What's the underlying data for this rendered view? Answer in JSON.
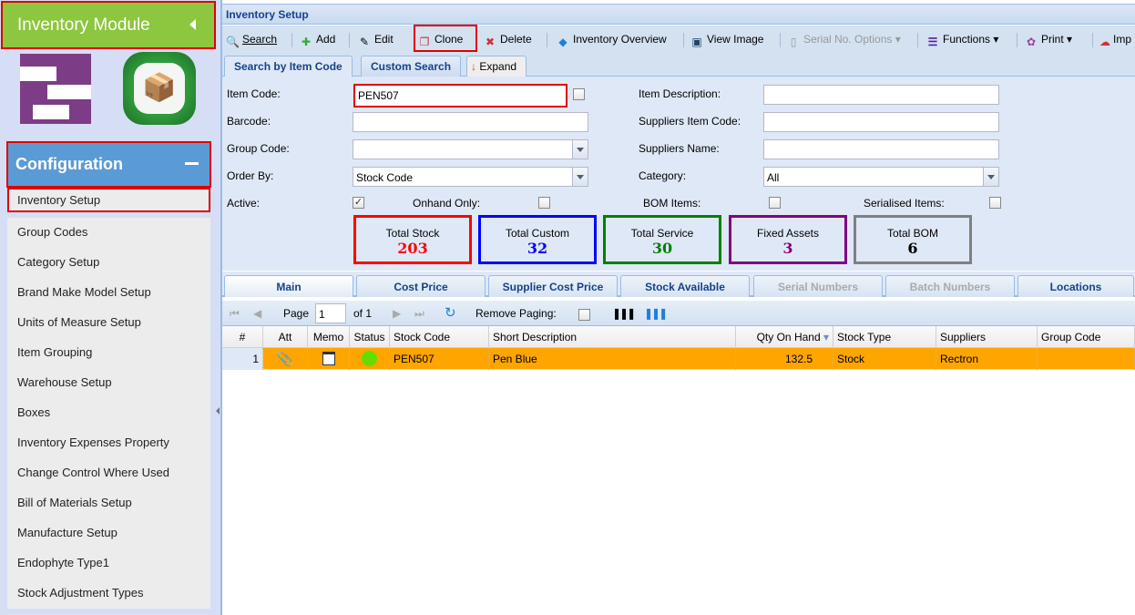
{
  "sidebar": {
    "module_title": "Inventory Module",
    "section_title": "Configuration",
    "items": [
      {
        "label": "Inventory Setup"
      },
      {
        "label": "Group Codes"
      },
      {
        "label": "Category Setup"
      },
      {
        "label": "Brand Make Model Setup"
      },
      {
        "label": "Units of Measure Setup"
      },
      {
        "label": "Item Grouping"
      },
      {
        "label": "Warehouse Setup"
      },
      {
        "label": "Boxes"
      },
      {
        "label": "Inventory Expenses Property"
      },
      {
        "label": "Change Control Where Used"
      },
      {
        "label": "Bill of Materials Setup"
      },
      {
        "label": "Manufacture Setup"
      },
      {
        "label": "Endophyte Type1"
      },
      {
        "label": "Stock Adjustment Types"
      }
    ]
  },
  "panel": {
    "title": "Inventory Setup"
  },
  "toolbar": {
    "search": "Search",
    "add": "Add",
    "edit": "Edit",
    "clone": "Clone",
    "delete": "Delete",
    "inventory_overview": "Inventory Overview",
    "view_image": "View Image",
    "serial_options": "Serial No. Options",
    "functions": "Functions",
    "print": "Print",
    "import": "Imp"
  },
  "search_tabs": {
    "by_item_code": "Search by Item Code",
    "custom": "Custom Search",
    "expand": "Expand"
  },
  "form": {
    "item_code_label": "Item Code:",
    "item_code_value": "PEN507",
    "barcode_label": "Barcode:",
    "barcode_value": "",
    "group_code_label": "Group Code:",
    "group_code_value": "",
    "order_by_label": "Order By:",
    "order_by_value": "Stock Code",
    "active_label": "Active:",
    "active_checked": true,
    "onhand_label": "Onhand Only:",
    "onhand_checked": false,
    "bom_label": "BOM Items:",
    "bom_checked": false,
    "serialised_label": "Serialised Items:",
    "serialised_checked": false,
    "item_desc_label": "Item Description:",
    "item_desc_value": "",
    "supp_item_code_label": "Suppliers Item Code:",
    "supp_item_code_value": "",
    "supp_name_label": "Suppliers Name:",
    "supp_name_value": "",
    "category_label": "Category:",
    "category_value": "All"
  },
  "stats": [
    {
      "label": "Total Stock",
      "value": "203",
      "color": "#ff0000"
    },
    {
      "label": "Total Custom",
      "value": "32",
      "color": "#0000ff"
    },
    {
      "label": "Total Service",
      "value": "30",
      "color": "#008000"
    },
    {
      "label": "Fixed Assets",
      "value": "3",
      "color": "#800080"
    },
    {
      "label": "Total BOM",
      "value": "6",
      "color": "#808080"
    }
  ],
  "detail_tabs": [
    {
      "label": "Main"
    },
    {
      "label": "Cost Price"
    },
    {
      "label": "Supplier Cost Price"
    },
    {
      "label": "Stock Available"
    },
    {
      "label": "Serial Numbers"
    },
    {
      "label": "Batch Numbers"
    },
    {
      "label": "Locations"
    }
  ],
  "pager": {
    "page_label": "Page",
    "page_value": "1",
    "of_label": "of 1",
    "remove_paging_label": "Remove Paging:"
  },
  "grid": {
    "columns": [
      "#",
      "Att",
      "Memo",
      "Status",
      "Stock Code",
      "Short Description",
      "Qty On Hand",
      "Stock Type",
      "Suppliers",
      "Group Code"
    ],
    "rows": [
      {
        "num": "1",
        "status_color": "#66dd00",
        "stock_code": "PEN507",
        "short_description": "Pen Blue",
        "qty_on_hand": "132.5",
        "stock_type": "Stock",
        "suppliers": "Rectron",
        "group_code": ""
      }
    ]
  }
}
